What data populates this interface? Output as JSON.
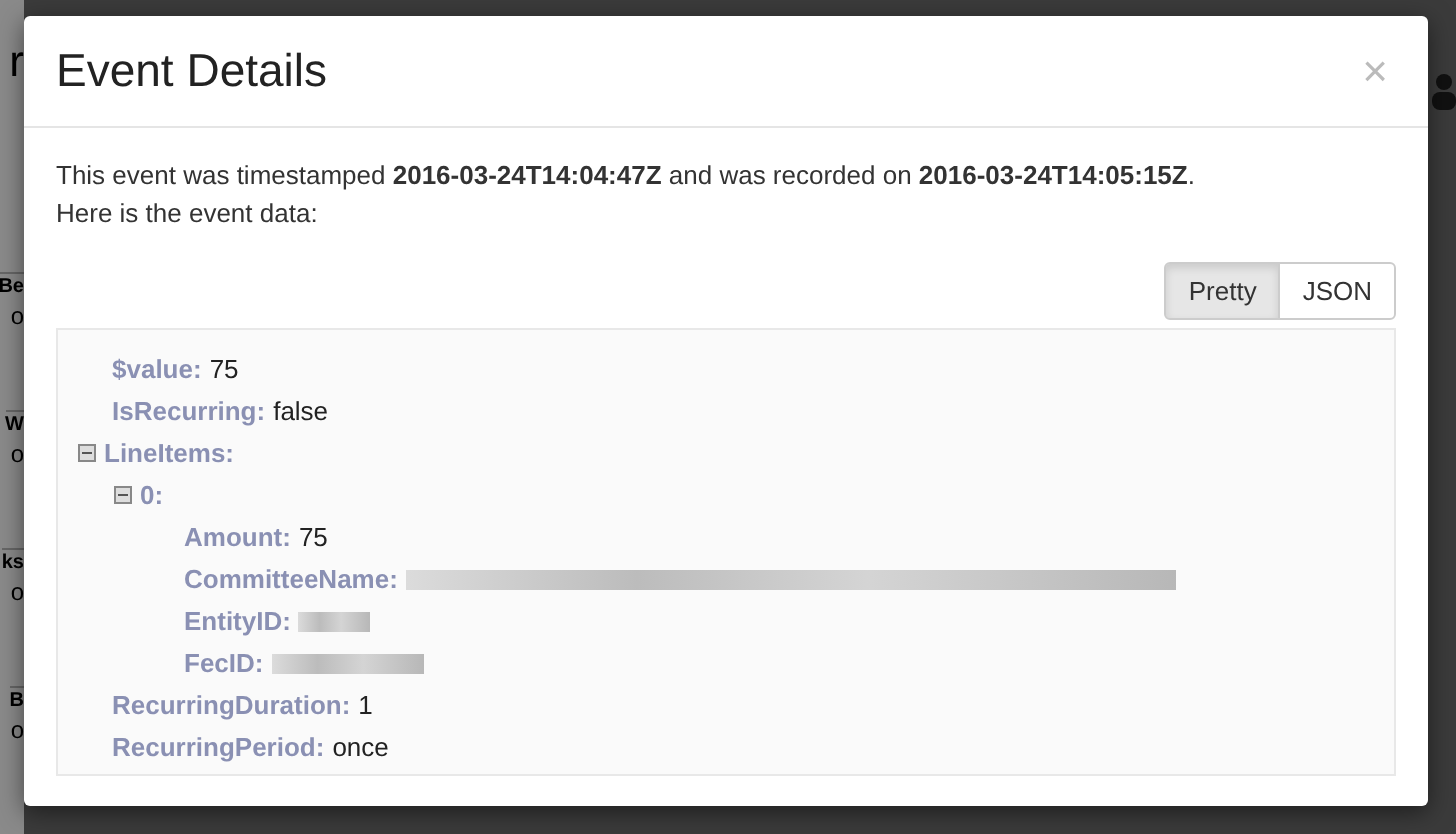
{
  "background": {
    "title": "r",
    "rows": [
      {
        "title": "Be",
        "subtitle": "o"
      },
      {
        "title": "W",
        "subtitle": "o"
      },
      {
        "title": "ks",
        "subtitle": "o"
      },
      {
        "title": "B",
        "subtitle": "o"
      }
    ]
  },
  "dialog": {
    "title": "Event Details",
    "close": "×",
    "intro": "This event was timestamped **2016-03-24T14:04:47Z** and was recorded on **2016-03-24T14:05:15Z**.",
    "intro_2": "Here is the event data:",
    "view_toggle": [
      {
        "label": "Pretty",
        "selected": true
      },
      {
        "label": "JSON",
        "selected": false
      }
    ],
    "data": [
      {
        "key": "$value:",
        "kind": "value",
        "value": "75"
      },
      {
        "key": "IsRecurring:",
        "kind": "value",
        "value": "false"
      },
      {
        "key": "LineItems:",
        "kind": "group",
        "expanded": true,
        "children": [
          {
            "key": "0:",
            "kind": "group",
            "expanded": true,
            "children": [
              {
                "key": "Amount:",
                "kind": "value",
                "value": "75"
              },
              {
                "key": "CommitteeName:",
                "kind": "redacted"
              },
              {
                "key": "EntityID:",
                "kind": "redacted"
              },
              {
                "key": "FecID:",
                "kind": "redacted"
              }
            ]
          }
        ]
      },
      {
        "key": "RecurringDuration:",
        "kind": "value",
        "value": "1"
      },
      {
        "key": "RecurringPeriod:",
        "kind": "value",
        "value": "once"
      }
    ]
  }
}
